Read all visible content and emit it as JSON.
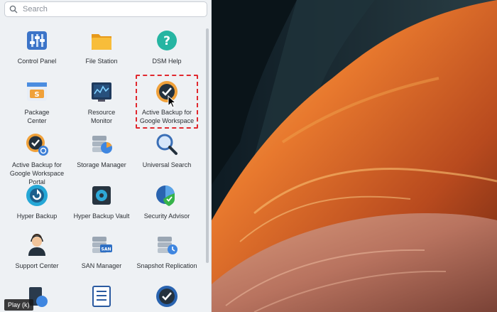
{
  "search": {
    "placeholder": "Search"
  },
  "apps": [
    {
      "name": "Control Panel",
      "icon": "control-panel-icon"
    },
    {
      "name": "File Station",
      "icon": "file-station-icon"
    },
    {
      "name": "DSM Help",
      "icon": "dsm-help-icon"
    },
    {
      "name": "Package\nCenter",
      "icon": "package-center-icon"
    },
    {
      "name": "Resource\nMonitor",
      "icon": "resource-monitor-icon"
    },
    {
      "name": "Active Backup for\nGoogle Workspace",
      "icon": "active-backup-google-workspace-icon"
    },
    {
      "name": "Active Backup for\nGoogle Workspace\nPortal",
      "icon": "active-backup-portal-icon"
    },
    {
      "name": "Storage Manager",
      "icon": "storage-manager-icon"
    },
    {
      "name": "Universal Search",
      "icon": "universal-search-icon"
    },
    {
      "name": "Hyper Backup",
      "icon": "hyper-backup-icon"
    },
    {
      "name": "Hyper Backup Vault",
      "icon": "hyper-backup-vault-icon"
    },
    {
      "name": "Security Advisor",
      "icon": "security-advisor-icon"
    },
    {
      "name": "Support Center",
      "icon": "support-center-icon"
    },
    {
      "name": "SAN Manager",
      "icon": "san-manager-icon"
    },
    {
      "name": "Snapshot Replication",
      "icon": "snapshot-replication-icon"
    },
    {
      "name": "",
      "icon": "app-icon-partial-1"
    },
    {
      "name": "",
      "icon": "app-icon-partial-2"
    },
    {
      "name": "",
      "icon": "app-icon-partial-3"
    }
  ],
  "tooltip": {
    "label": "Play (k)"
  },
  "colors": {
    "highlight": "#e0282e",
    "panel": "#eef1f4"
  }
}
